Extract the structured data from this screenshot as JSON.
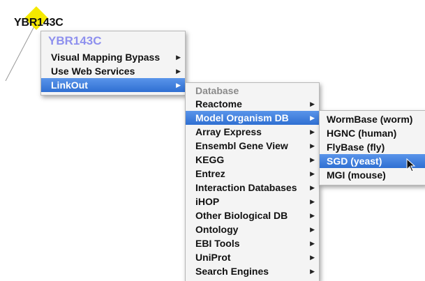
{
  "node": {
    "label": "YBR143C",
    "color": "#f5e900",
    "edge_color": "#999999"
  },
  "context_menu": {
    "title": "YBR143C",
    "items": [
      {
        "label": "Visual Mapping Bypass",
        "submenu": true,
        "selected": false
      },
      {
        "label": "Use Web Services",
        "submenu": true,
        "selected": false
      },
      {
        "label": "LinkOut",
        "submenu": true,
        "selected": true
      }
    ]
  },
  "linkout_menu": {
    "header": "Database",
    "items": [
      {
        "label": "Reactome",
        "submenu": true,
        "selected": false
      },
      {
        "label": "Model Organism DB",
        "submenu": true,
        "selected": true
      },
      {
        "label": "Array Express",
        "submenu": true,
        "selected": false
      },
      {
        "label": "Ensembl Gene View",
        "submenu": true,
        "selected": false
      },
      {
        "label": "KEGG",
        "submenu": true,
        "selected": false
      },
      {
        "label": "Entrez",
        "submenu": true,
        "selected": false
      },
      {
        "label": "Interaction Databases",
        "submenu": true,
        "selected": false
      },
      {
        "label": "iHOP",
        "submenu": true,
        "selected": false
      },
      {
        "label": "Other Biological DB",
        "submenu": true,
        "selected": false
      },
      {
        "label": "Ontology",
        "submenu": true,
        "selected": false
      },
      {
        "label": "EBI Tools",
        "submenu": true,
        "selected": false
      },
      {
        "label": "UniProt",
        "submenu": true,
        "selected": false
      },
      {
        "label": "Search Engines",
        "submenu": true,
        "selected": false
      }
    ]
  },
  "model_organism_menu": {
    "items": [
      {
        "label": "WormBase (worm)",
        "selected": false
      },
      {
        "label": "HGNC (human)",
        "selected": false
      },
      {
        "label": "FlyBase (fly)",
        "selected": false
      },
      {
        "label": "SGD (yeast)",
        "selected": true
      },
      {
        "label": "MGI (mouse)",
        "selected": false
      }
    ]
  },
  "colors": {
    "selection": "#3d7bd9",
    "title_accent": "#8e90ee",
    "header_gray": "#8a8a8a",
    "menu_background": "#f4f4f4"
  },
  "icons": {
    "submenu_arrow": "triangle-right-icon",
    "cursor": "arrow-cursor-icon"
  }
}
